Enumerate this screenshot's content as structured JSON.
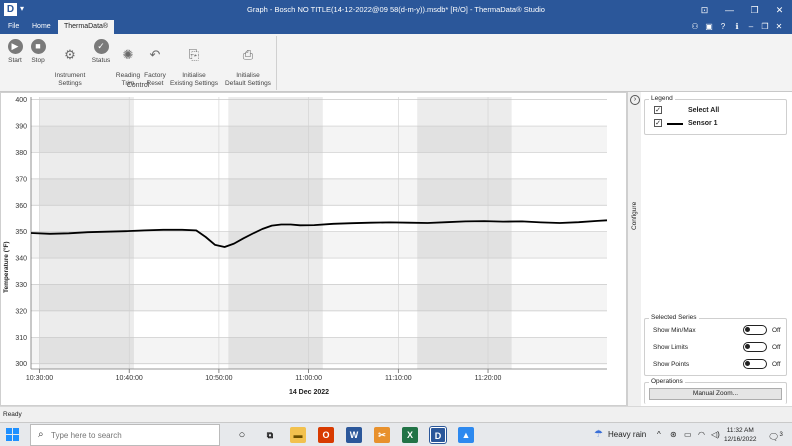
{
  "window": {
    "app_letter": "D",
    "title": "Graph - Bosch NO TITLE(14-12-2022@09 58(d-m-y)).msdb* [R/O] - ThermaData® Studio",
    "controls": [
      "⊡",
      "—",
      "❐",
      "✕"
    ]
  },
  "tabs": [
    "File",
    "Home",
    "ThermaData®"
  ],
  "ribbon": {
    "buttons": [
      {
        "label": "Start",
        "icon": "play-icon"
      },
      {
        "label": "Stop",
        "icon": "stop-icon"
      },
      {
        "label": "Instrument\nSettings",
        "icon": "gear-icon"
      },
      {
        "label": "Status",
        "icon": "checkmark-icon"
      },
      {
        "label": "Reading\nTrim",
        "icon": "trim-icon"
      },
      {
        "label": "Factory\nReset",
        "icon": "reset-icon"
      },
      {
        "label": "Initialise\nExisting Settings",
        "icon": "initialise-existing-icon"
      },
      {
        "label": "Initialise\nDefault Settings",
        "icon": "initialise-default-icon"
      }
    ],
    "group_label": "Control"
  },
  "chart_data": {
    "type": "line",
    "xlabel": "14 Dec 2022",
    "ylabel": "Temperature (°F)",
    "x_ticks": [
      "10:30:00",
      "10:40:00",
      "10:50:00",
      "11:00:00",
      "11:10:00",
      "11:20:00"
    ],
    "y_ticks": [
      300,
      310,
      320,
      330,
      340,
      350,
      360,
      370,
      380,
      390,
      400
    ],
    "ylim": [
      298,
      401
    ],
    "xlim_minutes": [
      0,
      61
    ],
    "grid": true,
    "series": [
      {
        "name": "Sensor 1",
        "color": "#000000",
        "x_minutes": [
          0,
          2,
          4,
          6,
          8,
          10,
          12,
          14,
          16,
          17.5,
          18.5,
          19.5,
          20.5,
          21.5,
          22.5,
          23.5,
          24.5,
          25.5,
          26.5,
          27.5,
          28.5,
          30,
          32,
          34,
          36,
          38,
          40,
          42,
          44,
          46,
          48,
          50,
          52,
          54,
          56,
          58,
          60,
          61
        ],
        "values": [
          349.5,
          349.2,
          349.4,
          349.8,
          350.0,
          350.2,
          350.5,
          350.7,
          350.7,
          350.5,
          348.0,
          345.0,
          344.2,
          345.5,
          347.5,
          349.3,
          351.0,
          352.3,
          352.7,
          352.7,
          352.4,
          352.5,
          353.0,
          353.2,
          353.4,
          353.5,
          353.4,
          353.3,
          353.6,
          353.9,
          354.0,
          353.8,
          353.9,
          353.5,
          353.3,
          353.6,
          354.1,
          354.3
        ]
      }
    ]
  },
  "legend_panel": {
    "configure_label": "Configure",
    "legend_title": "Legend",
    "select_all": "Select All",
    "series_label": "Sensor 1"
  },
  "selected_series": {
    "title": "Selected Series",
    "options": [
      {
        "label": "Show Min/Max",
        "state": "Off"
      },
      {
        "label": "Show Limits",
        "state": "Off"
      },
      {
        "label": "Show Points",
        "state": "Off"
      }
    ]
  },
  "operations": {
    "title": "Operations",
    "zoom_button": "Manual Zoom..."
  },
  "status": "Ready",
  "taskbar": {
    "search_placeholder": "Type here to search",
    "weather": "Heavy rain",
    "time": "11:32 AM",
    "date": "12/16/2022",
    "notification_count": "3",
    "colors": {
      "accent": "#2b579a"
    }
  }
}
